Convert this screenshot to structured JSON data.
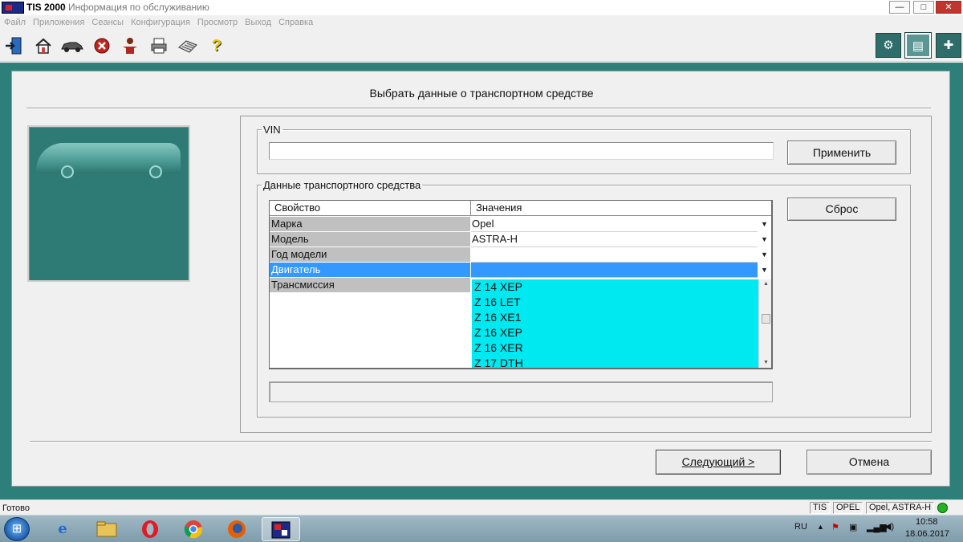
{
  "window": {
    "title_main": "TIS 2000",
    "title_sep": " - ",
    "title_sub": "Информация по обслуживанию",
    "controls": {
      "minimize": "—",
      "maximize": "□",
      "close": "✕"
    }
  },
  "menu": [
    "Файл",
    "Приложения",
    "Сеансы",
    "Конфигурация",
    "Просмотр",
    "Выход",
    "Справка"
  ],
  "toolbar": {
    "left_icons": [
      "exit-icon",
      "home-icon",
      "vehicle-icon",
      "stop-icon",
      "person-icon",
      "printer-icon",
      "keyboard-icon",
      "help-icon"
    ],
    "right_icons": [
      "diagnostics-icon",
      "vehicle-data-icon",
      "service-icon"
    ]
  },
  "dialog": {
    "heading": "Выбрать данные о транспортном средстве",
    "vin": {
      "legend": "VIN",
      "value": "",
      "apply_label": "Применить"
    },
    "vehicle": {
      "legend": "Данные транспортного средства",
      "col_property": "Свойство",
      "col_values": "Значения",
      "rows": [
        {
          "property": "Марка",
          "value": "Opel"
        },
        {
          "property": "Модель",
          "value": "ASTRA-H"
        },
        {
          "property": "Год модели",
          "value": ""
        },
        {
          "property": "Двигатель",
          "value": ""
        },
        {
          "property": "Трансмиссия",
          "value": ""
        }
      ],
      "engine_options": [
        "Z 14 XEP",
        "Z 16 LET",
        "Z 16 XE1",
        "Z 16 XEP",
        "Z 16 XER",
        "Z 17 DTH"
      ],
      "reset_label": "Сброс"
    },
    "next_label": "Следующий >",
    "cancel_label": "Отмена"
  },
  "statusbar": {
    "ready": "Готово",
    "cells": [
      "TIS",
      "OPEL",
      "Opel, ASTRA-H"
    ]
  },
  "taskbar": {
    "apps": [
      "ie-icon",
      "explorer-icon",
      "opera-icon",
      "chrome-icon",
      "firefox-icon",
      "tis-icon"
    ],
    "lang": "RU",
    "time": "10:58",
    "date": "18.06.2017"
  },
  "colors": {
    "teal_frame": "#2c8079",
    "selected_row": "#3399ff",
    "dropdown": "#00e8f0",
    "property_cell": "#c0c0c0"
  }
}
